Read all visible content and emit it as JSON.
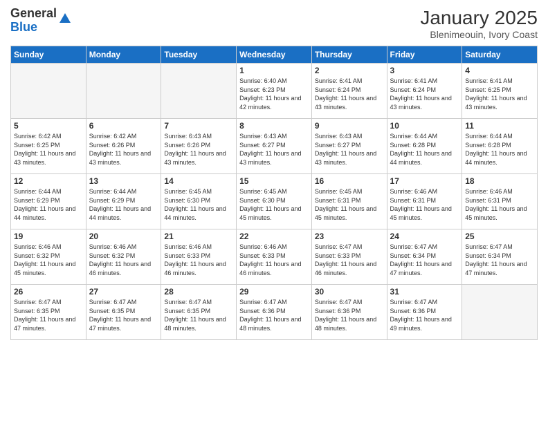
{
  "logo": {
    "general": "General",
    "blue": "Blue"
  },
  "header": {
    "title": "January 2025",
    "subtitle": "Blenimeouin, Ivory Coast"
  },
  "days_of_week": [
    "Sunday",
    "Monday",
    "Tuesday",
    "Wednesday",
    "Thursday",
    "Friday",
    "Saturday"
  ],
  "weeks": [
    [
      {
        "day": "",
        "sunrise": "",
        "sunset": "",
        "daylight": "",
        "empty": true
      },
      {
        "day": "",
        "sunrise": "",
        "sunset": "",
        "daylight": "",
        "empty": true
      },
      {
        "day": "",
        "sunrise": "",
        "sunset": "",
        "daylight": "",
        "empty": true
      },
      {
        "day": "1",
        "sunrise": "Sunrise: 6:40 AM",
        "sunset": "Sunset: 6:23 PM",
        "daylight": "Daylight: 11 hours and 42 minutes.",
        "empty": false
      },
      {
        "day": "2",
        "sunrise": "Sunrise: 6:41 AM",
        "sunset": "Sunset: 6:24 PM",
        "daylight": "Daylight: 11 hours and 43 minutes.",
        "empty": false
      },
      {
        "day": "3",
        "sunrise": "Sunrise: 6:41 AM",
        "sunset": "Sunset: 6:24 PM",
        "daylight": "Daylight: 11 hours and 43 minutes.",
        "empty": false
      },
      {
        "day": "4",
        "sunrise": "Sunrise: 6:41 AM",
        "sunset": "Sunset: 6:25 PM",
        "daylight": "Daylight: 11 hours and 43 minutes.",
        "empty": false
      }
    ],
    [
      {
        "day": "5",
        "sunrise": "Sunrise: 6:42 AM",
        "sunset": "Sunset: 6:25 PM",
        "daylight": "Daylight: 11 hours and 43 minutes.",
        "empty": false
      },
      {
        "day": "6",
        "sunrise": "Sunrise: 6:42 AM",
        "sunset": "Sunset: 6:26 PM",
        "daylight": "Daylight: 11 hours and 43 minutes.",
        "empty": false
      },
      {
        "day": "7",
        "sunrise": "Sunrise: 6:43 AM",
        "sunset": "Sunset: 6:26 PM",
        "daylight": "Daylight: 11 hours and 43 minutes.",
        "empty": false
      },
      {
        "day": "8",
        "sunrise": "Sunrise: 6:43 AM",
        "sunset": "Sunset: 6:27 PM",
        "daylight": "Daylight: 11 hours and 43 minutes.",
        "empty": false
      },
      {
        "day": "9",
        "sunrise": "Sunrise: 6:43 AM",
        "sunset": "Sunset: 6:27 PM",
        "daylight": "Daylight: 11 hours and 43 minutes.",
        "empty": false
      },
      {
        "day": "10",
        "sunrise": "Sunrise: 6:44 AM",
        "sunset": "Sunset: 6:28 PM",
        "daylight": "Daylight: 11 hours and 44 minutes.",
        "empty": false
      },
      {
        "day": "11",
        "sunrise": "Sunrise: 6:44 AM",
        "sunset": "Sunset: 6:28 PM",
        "daylight": "Daylight: 11 hours and 44 minutes.",
        "empty": false
      }
    ],
    [
      {
        "day": "12",
        "sunrise": "Sunrise: 6:44 AM",
        "sunset": "Sunset: 6:29 PM",
        "daylight": "Daylight: 11 hours and 44 minutes.",
        "empty": false
      },
      {
        "day": "13",
        "sunrise": "Sunrise: 6:44 AM",
        "sunset": "Sunset: 6:29 PM",
        "daylight": "Daylight: 11 hours and 44 minutes.",
        "empty": false
      },
      {
        "day": "14",
        "sunrise": "Sunrise: 6:45 AM",
        "sunset": "Sunset: 6:30 PM",
        "daylight": "Daylight: 11 hours and 44 minutes.",
        "empty": false
      },
      {
        "day": "15",
        "sunrise": "Sunrise: 6:45 AM",
        "sunset": "Sunset: 6:30 PM",
        "daylight": "Daylight: 11 hours and 45 minutes.",
        "empty": false
      },
      {
        "day": "16",
        "sunrise": "Sunrise: 6:45 AM",
        "sunset": "Sunset: 6:31 PM",
        "daylight": "Daylight: 11 hours and 45 minutes.",
        "empty": false
      },
      {
        "day": "17",
        "sunrise": "Sunrise: 6:46 AM",
        "sunset": "Sunset: 6:31 PM",
        "daylight": "Daylight: 11 hours and 45 minutes.",
        "empty": false
      },
      {
        "day": "18",
        "sunrise": "Sunrise: 6:46 AM",
        "sunset": "Sunset: 6:31 PM",
        "daylight": "Daylight: 11 hours and 45 minutes.",
        "empty": false
      }
    ],
    [
      {
        "day": "19",
        "sunrise": "Sunrise: 6:46 AM",
        "sunset": "Sunset: 6:32 PM",
        "daylight": "Daylight: 11 hours and 45 minutes.",
        "empty": false
      },
      {
        "day": "20",
        "sunrise": "Sunrise: 6:46 AM",
        "sunset": "Sunset: 6:32 PM",
        "daylight": "Daylight: 11 hours and 46 minutes.",
        "empty": false
      },
      {
        "day": "21",
        "sunrise": "Sunrise: 6:46 AM",
        "sunset": "Sunset: 6:33 PM",
        "daylight": "Daylight: 11 hours and 46 minutes.",
        "empty": false
      },
      {
        "day": "22",
        "sunrise": "Sunrise: 6:46 AM",
        "sunset": "Sunset: 6:33 PM",
        "daylight": "Daylight: 11 hours and 46 minutes.",
        "empty": false
      },
      {
        "day": "23",
        "sunrise": "Sunrise: 6:47 AM",
        "sunset": "Sunset: 6:33 PM",
        "daylight": "Daylight: 11 hours and 46 minutes.",
        "empty": false
      },
      {
        "day": "24",
        "sunrise": "Sunrise: 6:47 AM",
        "sunset": "Sunset: 6:34 PM",
        "daylight": "Daylight: 11 hours and 47 minutes.",
        "empty": false
      },
      {
        "day": "25",
        "sunrise": "Sunrise: 6:47 AM",
        "sunset": "Sunset: 6:34 PM",
        "daylight": "Daylight: 11 hours and 47 minutes.",
        "empty": false
      }
    ],
    [
      {
        "day": "26",
        "sunrise": "Sunrise: 6:47 AM",
        "sunset": "Sunset: 6:35 PM",
        "daylight": "Daylight: 11 hours and 47 minutes.",
        "empty": false
      },
      {
        "day": "27",
        "sunrise": "Sunrise: 6:47 AM",
        "sunset": "Sunset: 6:35 PM",
        "daylight": "Daylight: 11 hours and 47 minutes.",
        "empty": false
      },
      {
        "day": "28",
        "sunrise": "Sunrise: 6:47 AM",
        "sunset": "Sunset: 6:35 PM",
        "daylight": "Daylight: 11 hours and 48 minutes.",
        "empty": false
      },
      {
        "day": "29",
        "sunrise": "Sunrise: 6:47 AM",
        "sunset": "Sunset: 6:36 PM",
        "daylight": "Daylight: 11 hours and 48 minutes.",
        "empty": false
      },
      {
        "day": "30",
        "sunrise": "Sunrise: 6:47 AM",
        "sunset": "Sunset: 6:36 PM",
        "daylight": "Daylight: 11 hours and 48 minutes.",
        "empty": false
      },
      {
        "day": "31",
        "sunrise": "Sunrise: 6:47 AM",
        "sunset": "Sunset: 6:36 PM",
        "daylight": "Daylight: 11 hours and 49 minutes.",
        "empty": false
      },
      {
        "day": "",
        "sunrise": "",
        "sunset": "",
        "daylight": "",
        "empty": true
      }
    ]
  ]
}
